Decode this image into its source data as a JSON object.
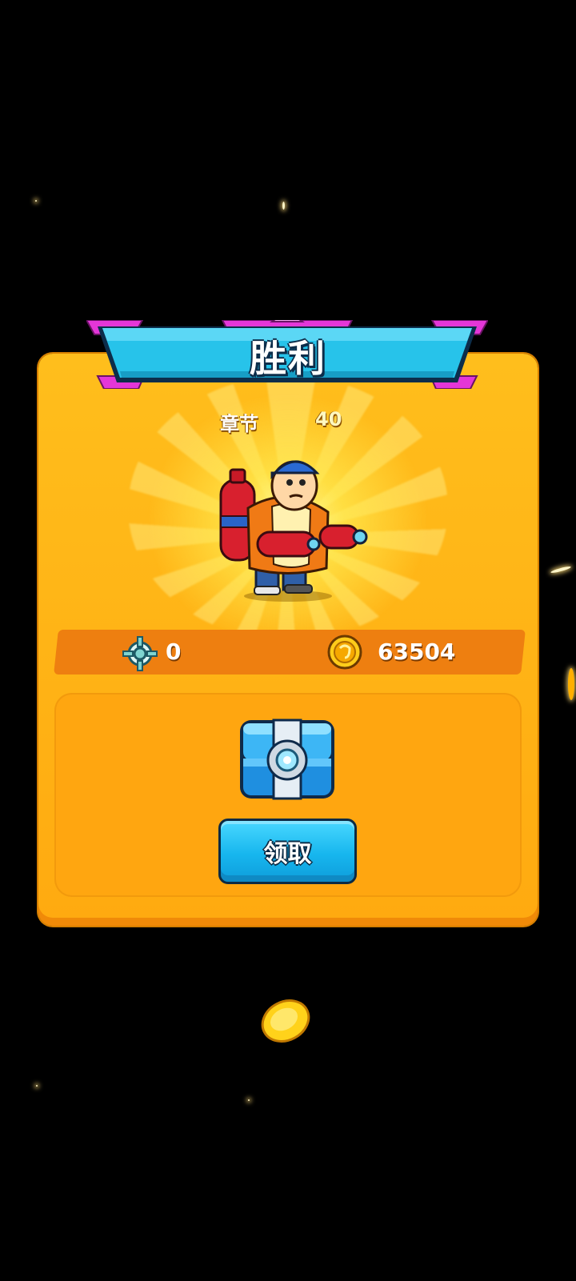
{
  "banner": {
    "title": "胜利"
  },
  "chapter": {
    "label": "章节",
    "value": "40"
  },
  "stats": {
    "target_count": "0",
    "coins": "63504"
  },
  "reward": {
    "claim_label": "领取"
  },
  "icons": {
    "target": "crosshair-icon",
    "coin": "coin-icon",
    "chest": "blue-chest-icon",
    "character": "chubby-man-with-soda-cannons"
  },
  "colors": {
    "card": "#ffb315",
    "banner": "#27c3ea",
    "banner_accent": "#e436d8",
    "strip": "#ee7f10",
    "button": "#1cbaf0"
  }
}
